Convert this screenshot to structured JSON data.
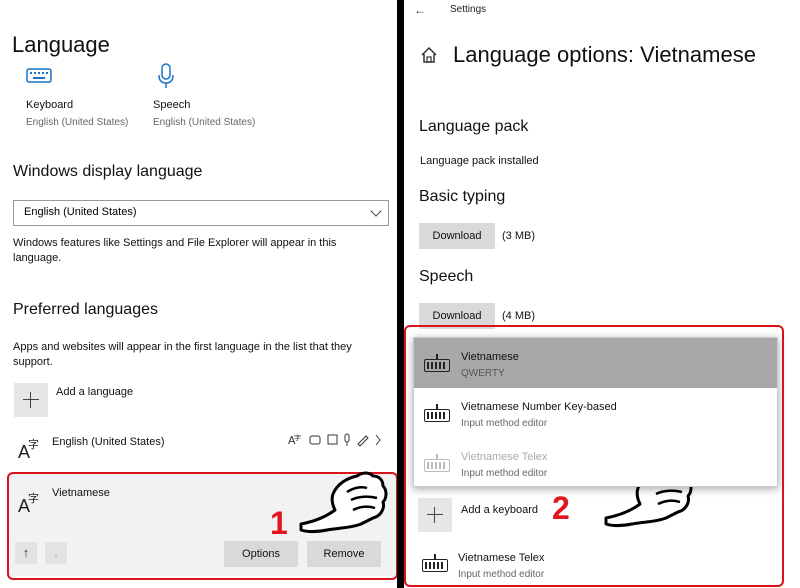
{
  "left": {
    "title": "Language",
    "tiles": [
      {
        "label": "Keyboard",
        "sub": "English (United States)",
        "icon": "keyboard-icon"
      },
      {
        "label": "Speech",
        "sub": "English (United States)",
        "icon": "microphone-icon"
      }
    ],
    "display_language": {
      "heading": "Windows display language",
      "selected": "English (United States)",
      "description_line1": "Windows features like Settings and File Explorer will appear in this",
      "description_line2": "language."
    },
    "preferred": {
      "heading": "Preferred languages",
      "description_line1": "Apps and websites will appear in the first language in the list that they",
      "description_line2": "support.",
      "add_label": "Add a language",
      "languages": [
        {
          "name": "English (United States)"
        },
        {
          "name": "Vietnamese"
        }
      ],
      "options_label": "Options",
      "remove_label": "Remove"
    },
    "step_marker": "1"
  },
  "right": {
    "window_title": "Settings",
    "title": "Language options: Vietnamese",
    "language_pack": {
      "heading": "Language pack",
      "status": "Language pack installed"
    },
    "basic_typing": {
      "heading": "Basic typing",
      "button": "Download",
      "size": "(3 MB)"
    },
    "speech": {
      "heading": "Speech",
      "button": "Download",
      "size": "(4 MB)"
    },
    "keyboard_options": [
      {
        "name": "Vietnamese",
        "sub": "QWERTY"
      },
      {
        "name": "Vietnamese Number Key-based",
        "sub": "Input method editor"
      },
      {
        "name": "Vietnamese Telex",
        "sub": "Input method editor"
      }
    ],
    "add_keyboard_label": "Add a keyboard",
    "installed_keyboard": {
      "name": "Vietnamese Telex",
      "sub": "Input method editor"
    },
    "step_marker": "2"
  },
  "colors": {
    "highlight": "#d9141c",
    "selected_row": "#a8a8a8",
    "button": "#d9d9d9"
  }
}
